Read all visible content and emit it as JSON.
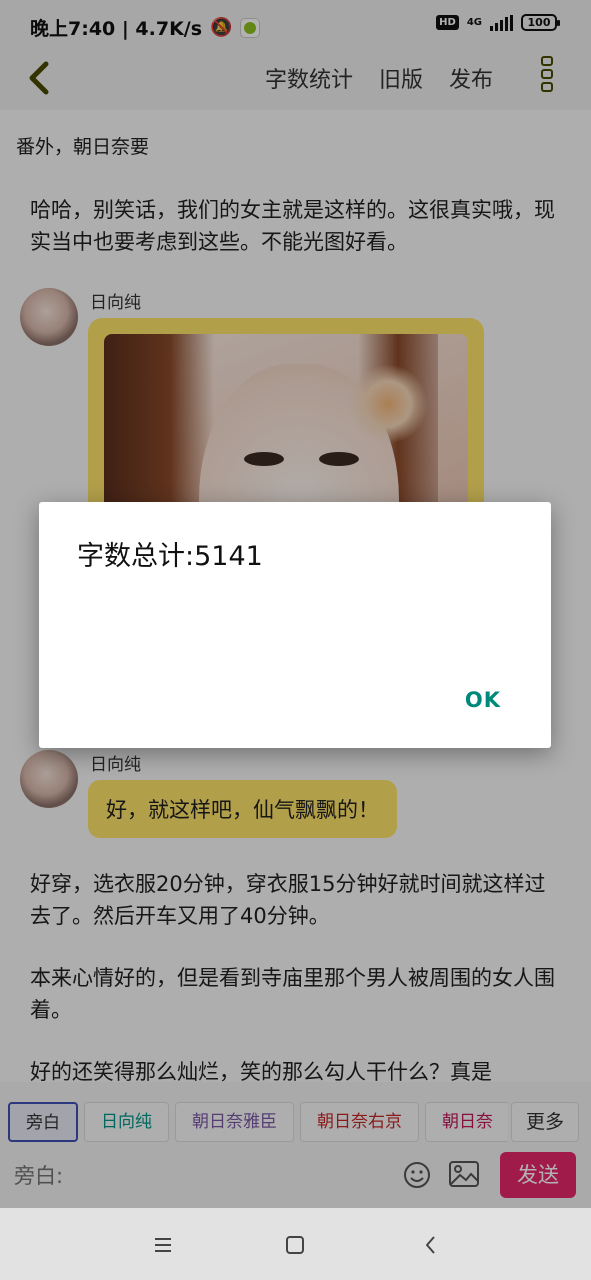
{
  "status_bar": {
    "time_text": "晚上7:40 | 4.7K/s",
    "hd": "HD",
    "network": "4G",
    "battery": "100"
  },
  "toolbar": {
    "actions": [
      "字数统计",
      "旧版",
      "发布"
    ]
  },
  "content": {
    "chapter_title": "番外，朝日奈要",
    "narration_1": "哈哈，别笑话，我们的女主就是这样的。这很真实哦，现实当中也要考虑到这些。不能光图好看。",
    "message_1": {
      "speaker": "日向纯"
    },
    "message_2": {
      "speaker": "日向纯",
      "text": "好，就这样吧，仙气飘飘的！"
    },
    "narration_2": "好穿，选衣服20分钟，穿衣服15分钟好就时间就这样过去了。然后开车又用了40分钟。",
    "narration_3": "本来心情好的，但是看到寺庙里那个男人被周围的女人围着。",
    "narration_4": "好的还笑得那么灿烂，笑的那么勾人干什么？真是"
  },
  "dialog": {
    "title": "字数总计:5141",
    "ok": "OK"
  },
  "input_area": {
    "roles": [
      {
        "label": "旁白",
        "color": "#333333"
      },
      {
        "label": "日向纯",
        "color": "#009688"
      },
      {
        "label": "朝日奈雅臣",
        "color": "#7b5aa6"
      },
      {
        "label": "朝日奈右京",
        "color": "#c62828"
      },
      {
        "label": "朝日奈",
        "color": "#c2185b"
      }
    ],
    "more_label": "更多",
    "placeholder": "旁白:",
    "send_label": "发送"
  },
  "colors": {
    "accent_yellow": "#ffe46b",
    "send_pink": "#e6286b",
    "ok_teal": "#00897b"
  }
}
